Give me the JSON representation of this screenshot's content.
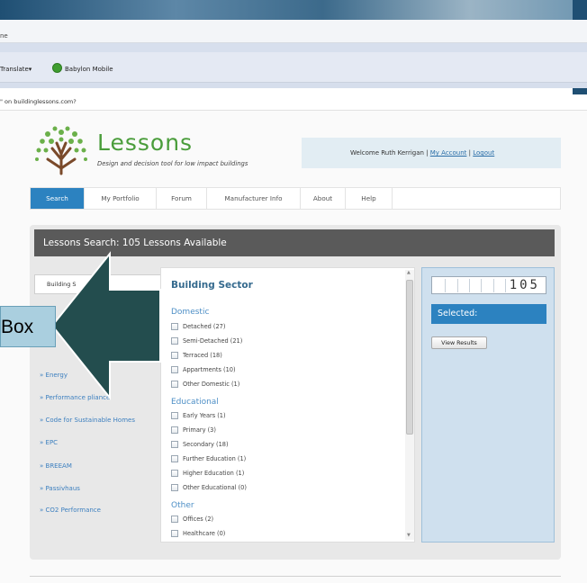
{
  "browser": {
    "status_fragment": "ne",
    "toolbar": {
      "translate": "Translate",
      "babylon": "Babylon Mobile"
    },
    "notification": "\" on buildinglessons.com?"
  },
  "header": {
    "logo_text": "Lessons",
    "tagline": "Design and decision tool for low impact buildings",
    "welcome_text": "Welcome Ruth Kerrigan |",
    "my_account": "My Account",
    "separator": "|",
    "logout": "Logout"
  },
  "nav": {
    "items": [
      {
        "label": "Search",
        "active": true
      },
      {
        "label": "My Portfolio",
        "active": false
      },
      {
        "label": "Forum",
        "active": false
      },
      {
        "label": "Manufacturer Info",
        "active": false
      },
      {
        "label": "About",
        "active": false
      },
      {
        "label": "Help",
        "active": false
      }
    ]
  },
  "search": {
    "header": "Lessons Search: 105 Lessons Available",
    "left_tab": "Building S",
    "left_links": [
      "Energy",
      "Performance      pliance",
      "Code for Sustainable Homes",
      "EPC",
      "BREEAM",
      "Passivhaus",
      "CO2 Performance"
    ],
    "sector_title": "Building Sector",
    "groups": [
      {
        "name": "Domestic",
        "options": [
          "Detached (27)",
          "Semi-Detached (21)",
          "Terraced (18)",
          "Appartments (10)",
          "Other Domestic (1)"
        ]
      },
      {
        "name": "Educational",
        "options": [
          "Early Years (1)",
          "Primary (3)",
          "Secondary (18)",
          "Further Education (1)",
          "Higher Education (1)",
          "Other Educational (0)"
        ]
      },
      {
        "name": "Other",
        "options": [
          "Offices (2)",
          "Healthcare (0)"
        ]
      }
    ],
    "counter": "105",
    "selected_label": "Selected:",
    "view_results": "View Results"
  },
  "annotation": {
    "callout_text": "Box"
  },
  "colors": {
    "accent": "#2c82c0",
    "logo_green": "#4a9d3b",
    "arrow": "#234d4e",
    "callout": "#aacfdf"
  }
}
